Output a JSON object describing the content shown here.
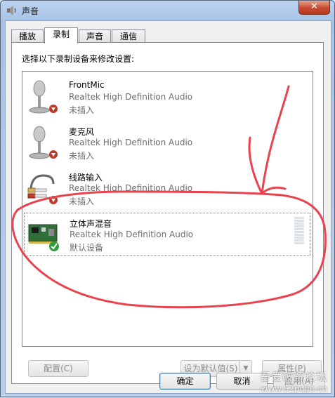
{
  "window": {
    "title": "声音",
    "close_label": "✕"
  },
  "tabs": [
    {
      "label": "播放"
    },
    {
      "label": "录制",
      "active": true
    },
    {
      "label": "声音"
    },
    {
      "label": "通信"
    }
  ],
  "instruction": "选择以下录制设备来修改设置:",
  "devices": [
    {
      "name": "FrontMic",
      "description": "Realtek High Definition Audio",
      "status": "未插入",
      "icon": "microphone-icon",
      "badge": "disconnected-badge-icon"
    },
    {
      "name": "麦克风",
      "description": "Realtek High Definition Audio",
      "status": "未插入",
      "icon": "microphone-icon",
      "badge": "disconnected-badge-icon"
    },
    {
      "name": "线路输入",
      "description": "Realtek High Definition Audio",
      "status": "未插入",
      "icon": "line-in-cable-icon",
      "badge": "disconnected-badge-icon"
    },
    {
      "name": "立体声混音",
      "description": "Realtek High Definition Audio",
      "status": "默认设备",
      "icon": "sound-card-icon",
      "badge": "default-checkmark-icon",
      "selected": true,
      "level": 0
    }
  ],
  "buttons": {
    "configure": "配置(C)",
    "set_default": "设为默认值(S)",
    "properties": "属性(P)",
    "ok": "确定",
    "cancel": "取消",
    "apply": "应用(A)"
  },
  "watermark": {
    "line1": "吾爱破解论坛",
    "line2": "www.52pojie.cn"
  },
  "colors": {
    "annotation": "#e8434e",
    "close": "#c7492f"
  }
}
